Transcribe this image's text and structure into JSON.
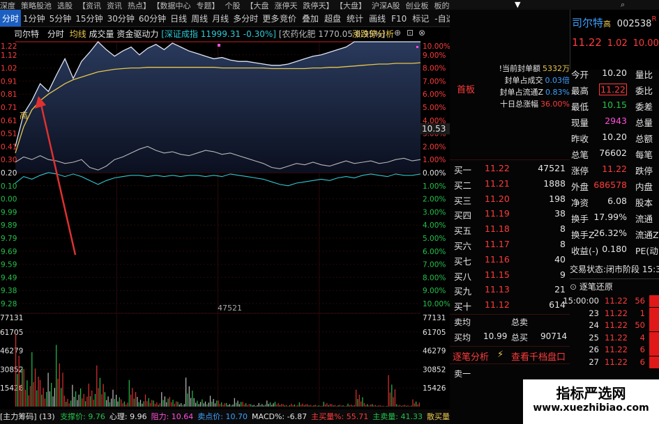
{
  "top_bar": [
    "深度",
    "策略股池",
    "选股",
    "【资讯",
    "资讯",
    "热点】",
    "【数据中心",
    "专题】",
    "个股",
    "【大盘",
    "涨停天",
    "跌停天】",
    "【大盘】",
    "沪深A股",
    "创业板",
    "板的"
  ],
  "menu": {
    "periods": [
      {
        "label": "分时",
        "active": true
      },
      {
        "label": "1分钟",
        "active": false
      },
      {
        "label": "5分钟",
        "active": false
      },
      {
        "label": "15分钟",
        "active": false
      },
      {
        "label": "30分钟",
        "active": false
      },
      {
        "label": "60分钟",
        "active": false
      },
      {
        "label": "日线",
        "active": false
      },
      {
        "label": "周线",
        "active": false
      },
      {
        "label": "月线",
        "active": false
      },
      {
        "label": "多分时",
        "active": false
      },
      {
        "label": "更多",
        "active": false
      }
    ],
    "tools": [
      "竞价",
      "叠加",
      "超盘",
      "统计",
      "画线",
      "F10",
      "标记",
      "-自选",
      "返回"
    ]
  },
  "chart_header": {
    "stock": "司尔特",
    "mode": "分时",
    "line1": "均线",
    "line2": "成交量",
    "line3": "资金驱动力",
    "index1": "[深证成指 11999.31 -0.30%]",
    "index2": "[农药化肥 1770.05 0.95%]",
    "tool": "涨跌停分析",
    "gao": "高"
  },
  "bottom_bar": {
    "title": "[主力筹码]",
    "count": "(13)",
    "items": [
      {
        "label": "支撑价: 9.76",
        "color": "#23c24a"
      },
      {
        "label": "心理: 9.96",
        "color": "#e5e5e5"
      },
      {
        "label": "阻力: 10.64",
        "color": "#ff4fd8"
      },
      {
        "label": "卖点价: 10.70",
        "color": "#3ea0ff"
      },
      {
        "label": "MACD%: -6.87",
        "color": "#e5e5e5"
      },
      {
        "label": "主买量%: 55.71",
        "color": "#ff3b3b"
      },
      {
        "label": "主卖量: 41.33",
        "color": "#23c24a"
      },
      {
        "label": "散买量: 1.02",
        "color": "#e8c64d"
      }
    ]
  },
  "chart_data": {
    "type": "line",
    "price_ticks": [
      "1.22",
      "1.12",
      "1.02",
      "0.91",
      "0.81",
      "0.71",
      "0.61",
      "0.51",
      "0.41",
      "0.30",
      "0.20",
      "0.10",
      "0.00",
      "9.99",
      "9.89",
      "9.79",
      "9.69",
      "9.59",
      "9.49",
      "9.38",
      "9.28"
    ],
    "pct_ticks": [
      "10.00%",
      "9.00%",
      "8.00%",
      "7.00%",
      "6.00%",
      "5.00%",
      "4.00%",
      "3.00%",
      "2.00%",
      "1.00%",
      "0.00%",
      "1.00%",
      "2.00%",
      "3.00%",
      "4.00%",
      "5.00%",
      "6.00%",
      "7.00%",
      "8.00%",
      "9.00%",
      "10.00%"
    ],
    "ylim_pct": [
      -10,
      10
    ],
    "pct_hline": 1.7,
    "price_label": "10.53",
    "volume_label": "47521",
    "volume_ticks_left": [
      "77131",
      "61705",
      "46279",
      "30852",
      "15426"
    ],
    "volume_ticks_right": [
      "77131",
      "61705",
      "46279",
      "30852",
      "15426"
    ],
    "volume_ylim": [
      0,
      77131
    ],
    "price_series": [
      2.0,
      4.5,
      5.5,
      6.8,
      6.2,
      7.5,
      8.7,
      7.2,
      8.5,
      9.2,
      10.0,
      9.4,
      8.9,
      9.3,
      9.6,
      9.0,
      9.5,
      9.8,
      9.4,
      9.9,
      9.6,
      9.3,
      9.1,
      8.9,
      8.7,
      8.8,
      8.6,
      8.5,
      8.5,
      8.4,
      8.3,
      8.2,
      8.2,
      8.3,
      8.5,
      8.7,
      8.9,
      9.0,
      9.2,
      9.4,
      9.6,
      10.0,
      10.0,
      10.0,
      10.0,
      10.0,
      10.0,
      10.0,
      10.0,
      10.0
    ],
    "avg_series": [
      1.5,
      3.5,
      4.8,
      5.5,
      6.0,
      6.4,
      6.8,
      7.1,
      7.3,
      7.5,
      7.7,
      7.8,
      7.9,
      7.95,
      8.0,
      8.0,
      8.05,
      8.05,
      8.05,
      8.05,
      8.05,
      8.05,
      8.05,
      8.05,
      8.05,
      8.0,
      8.0,
      8.0,
      8.0,
      8.0,
      8.0,
      7.95,
      7.95,
      7.95,
      7.95,
      7.95,
      8.0,
      8.0,
      8.05,
      8.05,
      8.1,
      8.15,
      8.2,
      8.25,
      8.3,
      8.3,
      8.35,
      8.35,
      8.35,
      8.4
    ],
    "white_series": [
      0.8,
      1.2,
      1.0,
      1.3,
      1.0,
      0.9,
      0.7,
      0.8,
      1.0,
      0.4,
      0.2,
      0.5,
      1.0,
      1.2,
      1.5,
      1.8,
      2.0,
      1.7,
      1.5,
      1.6,
      1.4,
      1.3,
      1.5,
      1.7,
      1.6,
      1.4,
      1.5,
      1.3,
      1.1,
      0.9,
      0.7,
      0.4,
      0.3,
      0.5,
      0.7,
      0.6,
      0.8,
      0.6,
      0.5,
      0.7,
      0.9,
      0.7,
      0.8,
      0.9,
      0.7,
      0.8,
      1.0,
      1.1,
      0.9,
      1.0
    ],
    "cyan_series": [
      -0.8,
      -0.3,
      -0.5,
      -0.2,
      0.0,
      -0.1,
      -0.3,
      -0.1,
      -0.3,
      -0.6,
      -0.9,
      -0.6,
      -0.4,
      -0.3,
      -0.2,
      -0.2,
      -0.3,
      -0.2,
      -0.3,
      -0.2,
      -0.3,
      -0.2,
      -0.2,
      -0.3,
      -0.2,
      -0.3,
      -0.1,
      -0.2,
      -0.3,
      -0.4,
      -0.5,
      -0.7,
      -0.9,
      -1.0,
      -0.8,
      -0.7,
      -0.6,
      -0.5,
      -0.6,
      -0.4,
      -0.3,
      -0.4,
      -0.2,
      -0.1,
      -0.2,
      -0.3,
      -0.1,
      -0.2,
      -0.2,
      -0.1
    ],
    "volumes": [
      60000,
      31000,
      45000,
      22000,
      28000,
      51000,
      9000,
      18000,
      15000,
      19000,
      34000,
      12000,
      14000,
      6000,
      22000,
      8000,
      10000,
      5000,
      12000,
      8000,
      4000,
      24000,
      7000,
      6000,
      9000,
      5000,
      3000,
      7000,
      4000,
      2000,
      3000,
      5000,
      4000,
      2000,
      2500,
      3500,
      2000,
      1500,
      4000,
      2000,
      1500,
      2500,
      14000,
      3000,
      2000,
      1000,
      26000,
      2000,
      1500,
      6000
    ]
  },
  "quote": {
    "name": "司尔特",
    "gao_mark": "高",
    "code": "002538",
    "r_mark": "R",
    "price": "11.22",
    "change": "1.02",
    "change_pct": "10.00%",
    "seal": {
      "first_board": "首板",
      "rows": [
        {
          "label": "!当前封单额",
          "value": "5332万",
          "color": "#e8c64d"
        },
        {
          "label": "封单占成交",
          "value": "0.03倍",
          "color": "#3ea0ff"
        },
        {
          "label": "封单占流通Z",
          "value": "0.83%",
          "color": "#3ea0ff"
        },
        {
          "label": "十日总涨幅",
          "value": "36.00%",
          "color": "#ff3b3b"
        }
      ]
    },
    "side_price": "10.53",
    "stats": [
      {
        "l1": "今开",
        "v1": "10.20",
        "c1": "#e5e5e5",
        "l2": "量比"
      },
      {
        "l1": "最高",
        "v1": "11.22",
        "c1": "#ff3b3b",
        "l2": "委比",
        "boxed": true
      },
      {
        "l1": "最低",
        "v1": "10.15",
        "c1": "#23c24a",
        "l2": "委差"
      },
      {
        "l1": "现量",
        "v1": "2943",
        "c1": "#ff4fd8",
        "l2": "总量"
      },
      {
        "l1": "昨收",
        "v1": "10.20",
        "c1": "#e5e5e5",
        "l2": "总额"
      },
      {
        "l1": "总笔",
        "v1": "76602",
        "c1": "#e5e5e5",
        "l2": "每笔"
      },
      {
        "l1": "涨停",
        "v1": "11.22",
        "c1": "#ff3b3b",
        "l2": "跌停"
      },
      {
        "l1": "外盘",
        "v1": "686578",
        "c1": "#ff3b3b",
        "l2": "内盘"
      },
      {
        "l1": "净资",
        "v1": "6.08",
        "c1": "#e5e5e5",
        "l2": "股本"
      },
      {
        "l1": "换手",
        "v1": "17.99%",
        "c1": "#e5e5e5",
        "l2": "流通"
      },
      {
        "l1": "换手Z",
        "v1": "26.32%",
        "c1": "#e5e5e5",
        "l2": "流通Z"
      },
      {
        "l1": "收益(-)",
        "v1": "0.180",
        "c1": "#e5e5e5",
        "l2": "PE(动)"
      }
    ],
    "trade_status": {
      "label": "交易状态:",
      "value": "闭市阶段",
      "time": "15:32"
    },
    "tick_title": "逐笔还原",
    "ticks": [
      {
        "time": "15:00:00",
        "price": "11.22",
        "vol": "56"
      },
      {
        "time": "23",
        "price": "11.22",
        "vol": "1"
      },
      {
        "time": "24",
        "price": "11.22",
        "vol": "50"
      },
      {
        "time": "25",
        "price": "11.22",
        "vol": "4"
      },
      {
        "time": "26",
        "price": "11.22",
        "vol": "6"
      },
      {
        "time": "27",
        "price": "11.22",
        "vol": "6"
      }
    ],
    "bids": [
      {
        "label": "买一",
        "price": "11.22",
        "vol": "47521"
      },
      {
        "label": "买二",
        "price": "11.21",
        "vol": "1888"
      },
      {
        "label": "买三",
        "price": "11.20",
        "vol": "198"
      },
      {
        "label": "买四",
        "price": "11.19",
        "vol": "38"
      },
      {
        "label": "买五",
        "price": "11.18",
        "vol": "8"
      },
      {
        "label": "买六",
        "price": "11.17",
        "vol": "8"
      },
      {
        "label": "买七",
        "price": "11.16",
        "vol": "40"
      },
      {
        "label": "买八",
        "price": "11.15",
        "vol": "9"
      },
      {
        "label": "买九",
        "price": "11.13",
        "vol": "21"
      },
      {
        "label": "买十",
        "price": "11.12",
        "vol": "614"
      }
    ],
    "sell_avg": {
      "label": "卖均",
      "total_label": "总卖"
    },
    "buy_avg": {
      "label": "买均",
      "value": "10.99",
      "total_label": "总买",
      "total": "90714"
    },
    "analysis_button": "逐笔分析",
    "depth_button": "查看千档盘口",
    "sell_one": "卖一"
  },
  "watermark": {
    "line1": "指标严选网",
    "line2": "www.xuezhibiao.com"
  }
}
